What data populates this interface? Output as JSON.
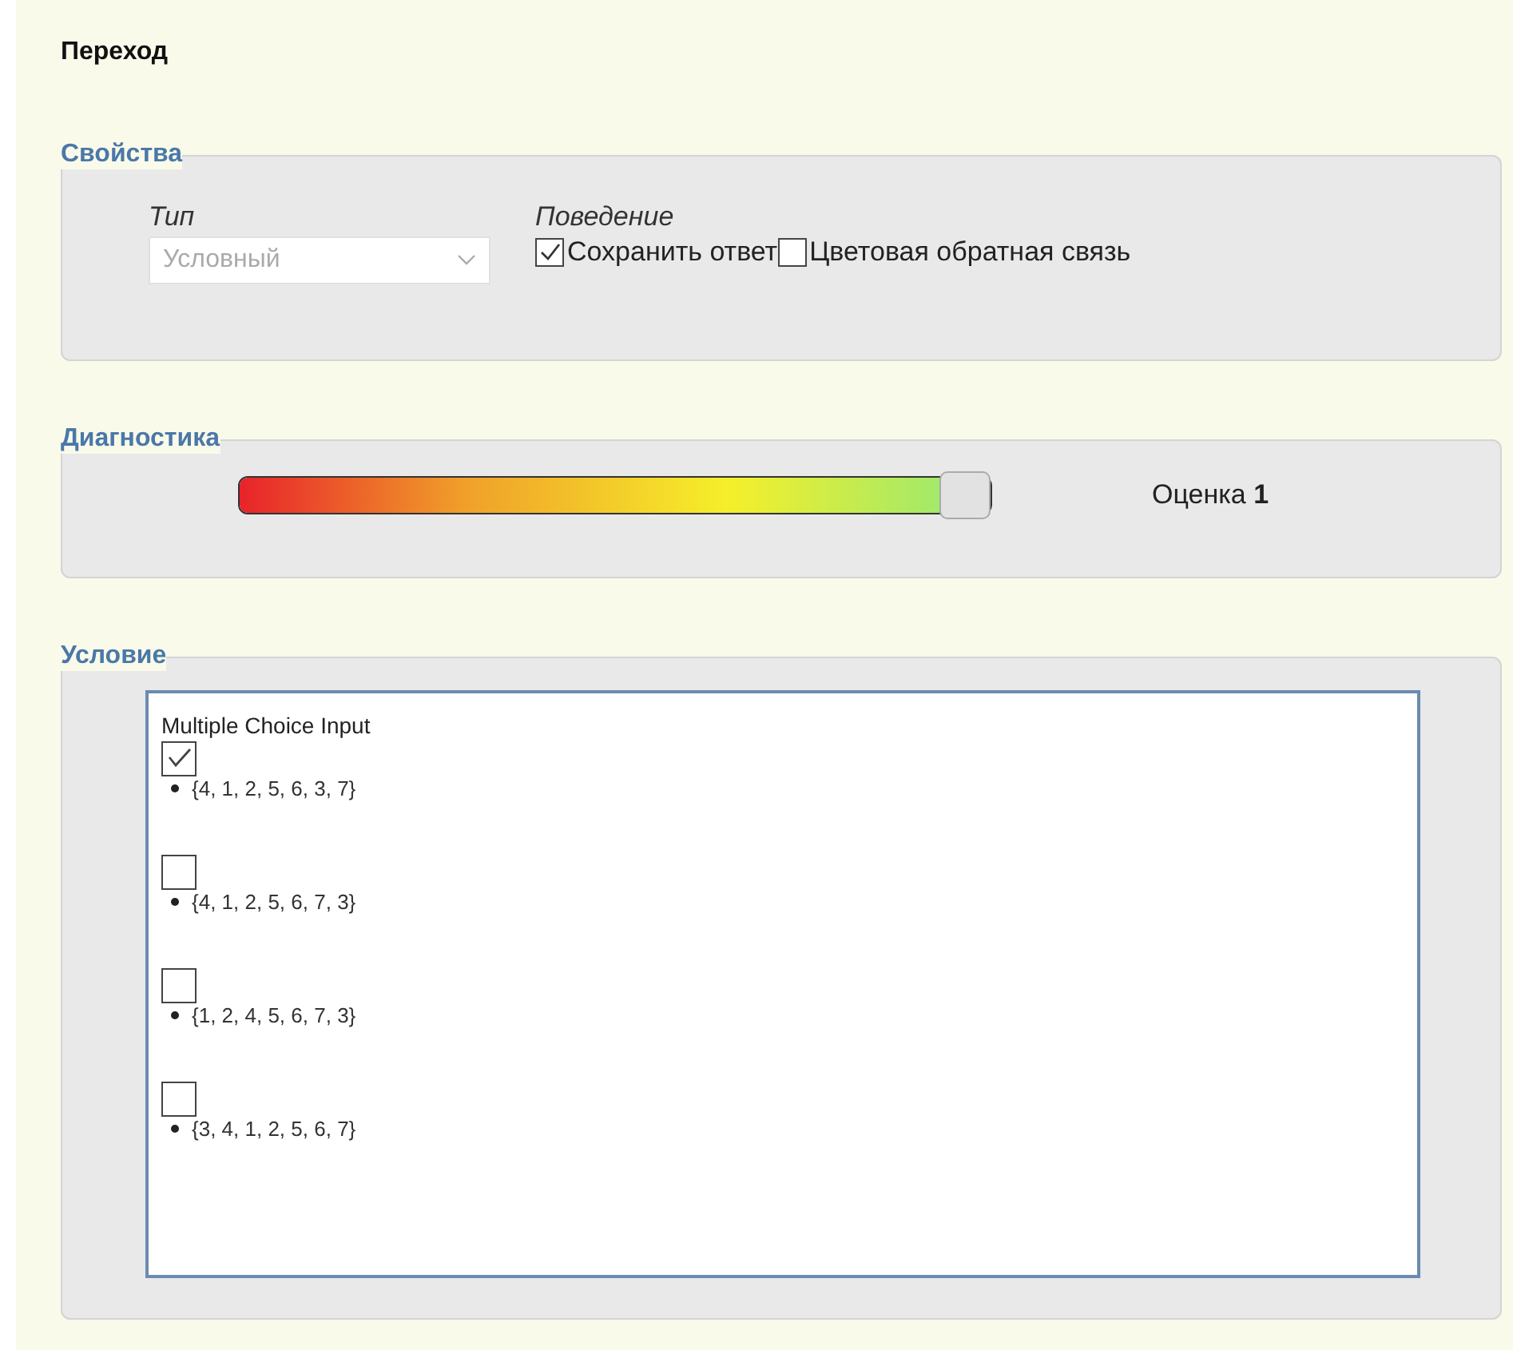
{
  "title": "Переход",
  "properties": {
    "legend": "Свойства",
    "type_label": "Тип",
    "type_select": {
      "value": "Условный",
      "disabled": true
    },
    "behavior_label": "Поведение",
    "checkboxes": [
      {
        "label": "Сохранить ответ",
        "checked": true
      },
      {
        "label": "Цветовая обратная связь",
        "checked": false
      }
    ]
  },
  "diagnostics": {
    "legend": "Диагностика",
    "slider": {
      "level": 1
    },
    "score": "Оценка **1**"
  },
  "condition": {
    "legend": "Условие",
    "heading": "Multiple Choice Input",
    "options": [
      {
        "text": "{4, 1, 2, 5, 6, 3, 7}",
        "checked": true
      },
      {
        "text": "{4, 1, 2, 5, 6, 7, 3}",
        "checked": false
      },
      {
        "text": "{1, 2, 4, 5, 6, 7, 3}",
        "checked": false
      },
      {
        "text": "{3, 4, 1, 2, 5, 6, 7}",
        "checked": false
      }
    ]
  }
}
